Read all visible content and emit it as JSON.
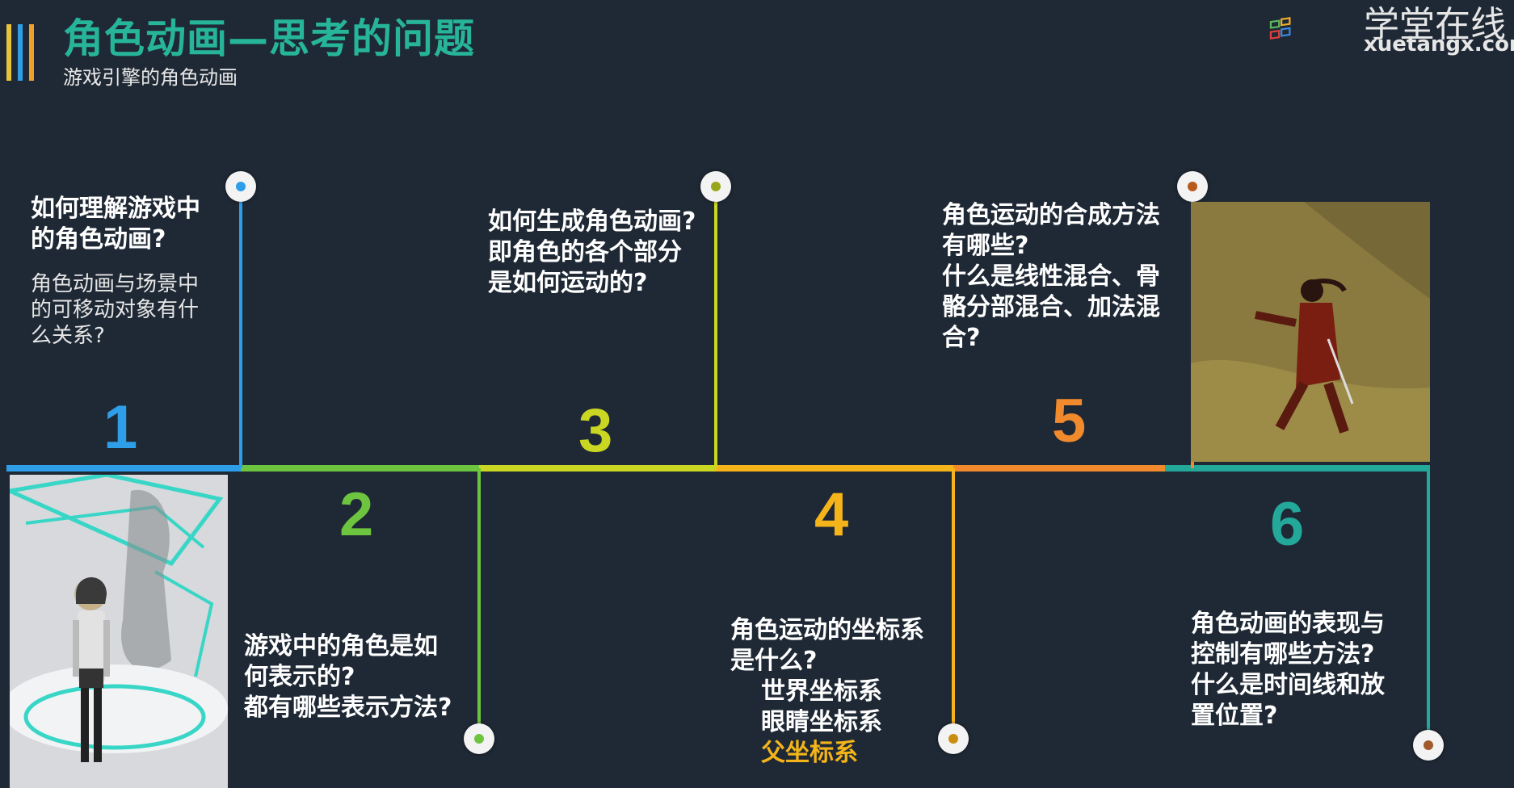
{
  "header": {
    "title": "角色动画—思考的问题",
    "subtitle": "游戏引擎的角色动画"
  },
  "logo": {
    "cn": "学堂在线",
    "en": "xuetangx.com"
  },
  "colors": {
    "c1": "#2f9ee8",
    "c2": "#6dc43f",
    "c3": "#c9d622",
    "c4": "#f4b41a",
    "c5": "#f08a2c",
    "c6": "#24a89a"
  },
  "items": [
    {
      "number": "1",
      "question": [
        "如何理解游戏中",
        "的角色动画?"
      ],
      "sub": [
        "角色动画与场景中",
        "的可移动对象有什",
        "么关系?"
      ]
    },
    {
      "number": "2",
      "question": [
        "游戏中的角色是如",
        "何表示的?",
        "都有哪些表示方法?"
      ]
    },
    {
      "number": "3",
      "question": [
        "如何生成角色动画?",
        "即角色的各个部分",
        "是如何运动的?"
      ]
    },
    {
      "number": "4",
      "question": [
        "角色运动的坐标系",
        "是什么?"
      ],
      "sub_items": [
        "世界坐标系",
        "眼睛坐标系",
        "父坐标系"
      ]
    },
    {
      "number": "5",
      "question": [
        "角色运动的合成方法",
        "有哪些?",
        "什么是线性混合、骨",
        "骼分部混合、加法混",
        "合?"
      ]
    },
    {
      "number": "6",
      "question": [
        "角色动画的表现与",
        "控制有哪些方法?",
        "什么是时间线和放",
        "置位置?"
      ]
    }
  ]
}
